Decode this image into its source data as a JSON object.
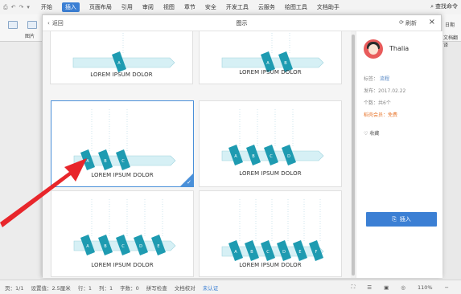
{
  "menubar": {
    "quick": [
      "文件",
      "⎙",
      "↶",
      "↷",
      "▾"
    ],
    "items": [
      "开始",
      "插入",
      "页面布局",
      "引用",
      "审阅",
      "视图",
      "章节",
      "安全",
      "开发工具",
      "云服务",
      "绘图工具",
      "文档助手"
    ],
    "active_index": 1,
    "search": "查找命令"
  },
  "ribbon": {
    "left_label": "图片",
    "right_label": "文档翻译",
    "top_right": "日期"
  },
  "dialog": {
    "back_label": "返回",
    "title": "图示",
    "refresh_label": "刷新",
    "close_icon": "×"
  },
  "templates": [
    {
      "caption": "LOREM IPSUM DOLOR",
      "letters": [
        "A"
      ],
      "selected": false
    },
    {
      "caption": "LOREM IPSUM DOLOR",
      "letters": [
        "A",
        "B"
      ],
      "selected": false
    },
    {
      "caption": "LOREM IPSUM DOLOR",
      "letters": [
        "A",
        "B",
        "C"
      ],
      "selected": true
    },
    {
      "caption": "LOREM IPSUM DOLOR",
      "letters": [
        "A",
        "B",
        "C",
        "D"
      ],
      "selected": false
    },
    {
      "caption": "LOREM IPSUM DOLOR",
      "letters": [
        "A",
        "B",
        "C",
        "D",
        "E"
      ],
      "selected": false
    },
    {
      "caption": "LOREM IPSUM DOLOR",
      "letters": [
        "A",
        "B",
        "C",
        "D",
        "E",
        "F"
      ],
      "selected": false
    }
  ],
  "side": {
    "user": "Thalia",
    "tag_label": "标签：",
    "tag_value": "流程",
    "date_label": "发布：",
    "date_value": "2017.02.22",
    "count_label": "个数：",
    "count_value": "共6个",
    "member_label": "稻壳会员：",
    "member_value": "免费",
    "favorite": "收藏",
    "insert_label": "插入"
  },
  "status": {
    "page": "页：1/1",
    "pos": "设置值：2.5厘米",
    "row": "行：1",
    "col": "列：1",
    "words": "字数：0",
    "spell": "拼写检查",
    "proof": "文档校对",
    "cert": "未认证",
    "zoom": "110%"
  },
  "colors": {
    "accent": "#3b7fd4",
    "ribbon_teal": "#1e9bb1",
    "banner_light": "#d6f0f5",
    "arrow_red": "#e8262b"
  }
}
